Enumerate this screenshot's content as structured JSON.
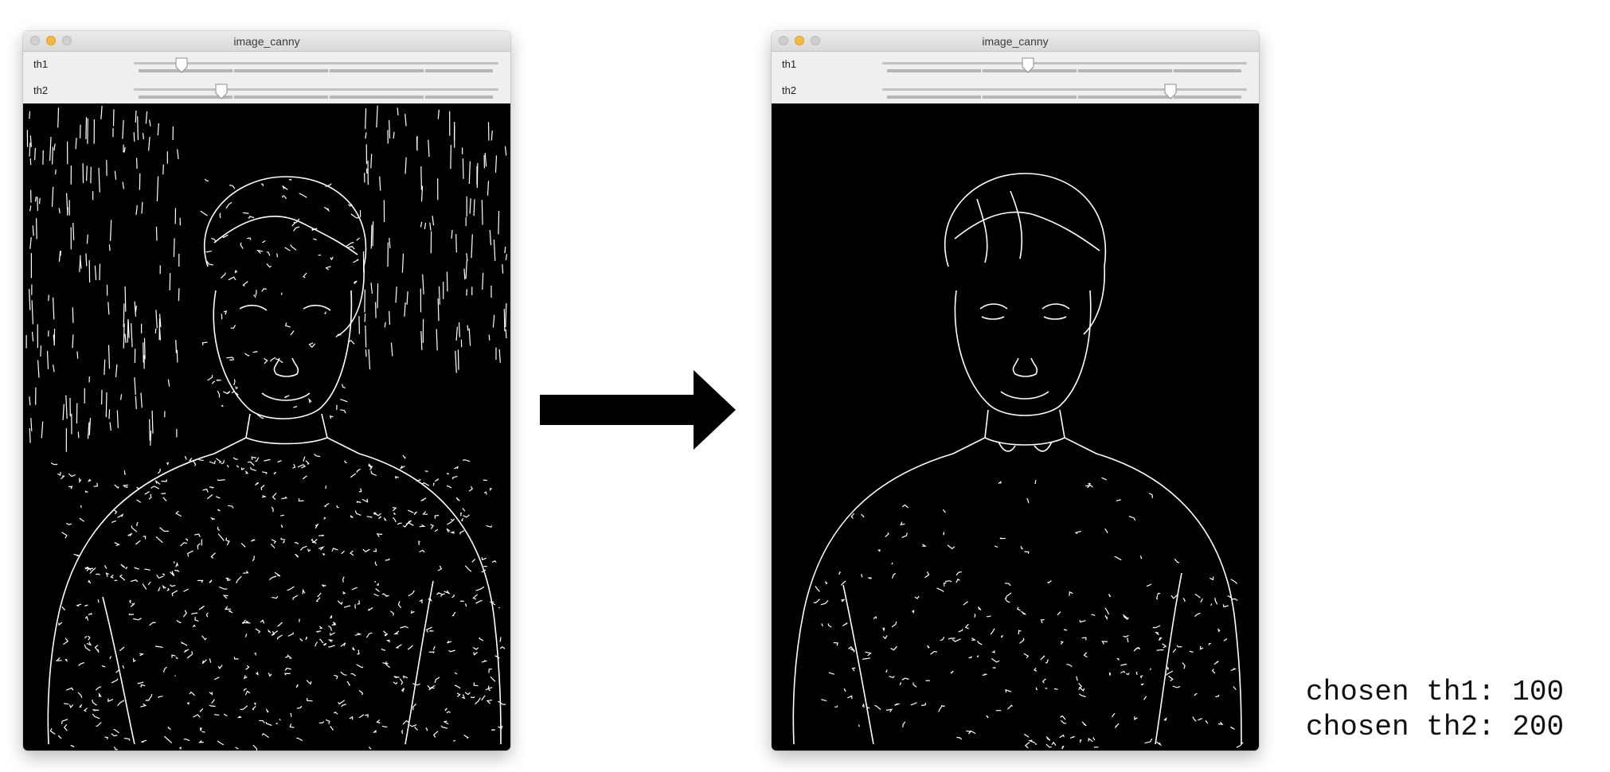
{
  "windows": [
    {
      "title": "image_canny",
      "sliders": [
        {
          "label": "th1",
          "value_fraction": 0.13
        },
        {
          "label": "th2",
          "value_fraction": 0.24
        }
      ]
    },
    {
      "title": "image_canny",
      "sliders": [
        {
          "label": "th1",
          "value_fraction": 0.4
        },
        {
          "label": "th2",
          "value_fraction": 0.79
        }
      ]
    }
  ],
  "output": {
    "line1": "chosen th1: 100",
    "line2": "chosen th2: 200"
  },
  "colors": {
    "canvas_background": "#000000",
    "edges": "#ffffff",
    "traffic_light_active": "#f5b840"
  },
  "icons": {
    "arrow": "right-arrow-icon",
    "slider_thumb": "slider-thumb-icon"
  }
}
